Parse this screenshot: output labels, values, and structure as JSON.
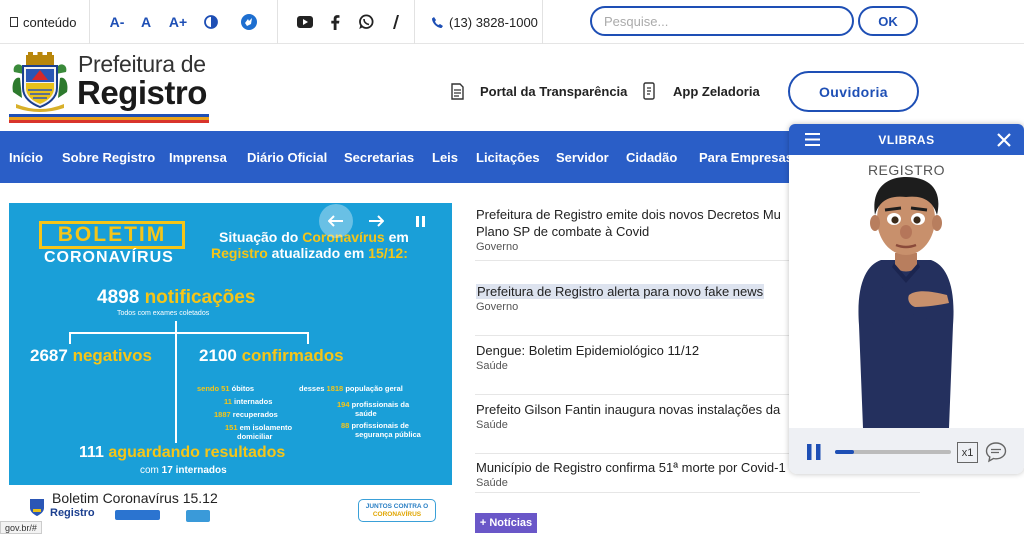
{
  "topbar": {
    "skip_content": "conteúdo",
    "font_decrease": "A-",
    "font_reset": "A",
    "font_increase": "A+",
    "phone": "(13) 3828-1000",
    "search_placeholder": "Pesquise...",
    "search_button": "OK"
  },
  "header": {
    "title_line1": "Prefeitura de",
    "title_line2": "Registro",
    "links": [
      "Portal da Transparência",
      "App Zeladoria"
    ],
    "ouvidoria": "Ouvidoria"
  },
  "nav": [
    "Início",
    "Sobre Registro",
    "Imprensa",
    "Diário Oficial",
    "Secretarias",
    "Leis",
    "Licitações",
    "Servidor",
    "Cidadão",
    "Para Empresas"
  ],
  "slider": {
    "badge_top": "BOLETIM",
    "badge_bottom": "CORONAVÍRUS",
    "heading_line1_a": "Situação do ",
    "heading_line1_b": "Coronavírus",
    "heading_line1_c": " em",
    "heading_line2_a": "Registro",
    "heading_line2_b": " atualizado em ",
    "heading_line2_c": "15/12:",
    "notif_num": "4898",
    "notif_label": "notificações",
    "notif_sub": "Todos com exames coletados",
    "neg_num": "2687",
    "neg_label": "negativos",
    "conf_num": "2100",
    "conf_label": "confirmados",
    "s1_num": "sendo 51",
    "s1_label": "óbitos",
    "s2_num": "11",
    "s2_label": "internados",
    "s3_num": "1887",
    "s3_label": "recuperados",
    "s4_num": "151",
    "s4_label": "em isolamento",
    "s4_label2": "domiciliar",
    "d1_pre": "desses",
    "d1_num": "1818",
    "d1_label": "população geral",
    "d2_num": "194",
    "d2_label": "profissionais da",
    "d2_label2": "saúde",
    "d3_num": "88",
    "d3_label": "profissionais de",
    "d3_label2": "segurança pública",
    "wait_num": "111",
    "wait_label": "aguardando resultados",
    "wait_sub_a": "com ",
    "wait_sub_b": "17 internados",
    "caption": "Boletim Coronavírus 15.12",
    "footer_logo": "Registro",
    "footer_badge_line1": "JUNTOS CONTRA O",
    "footer_badge_line2": "CORONAVÍRUS"
  },
  "news": [
    {
      "title": "Prefeitura de Registro emite dois novos Decretos Mu",
      "title2": "Plano SP de combate à Covid",
      "category": "Governo"
    },
    {
      "title": "Prefeitura de Registro alerta para novo fake news",
      "category": "Governo"
    },
    {
      "title": "Dengue: Boletim Epidemiológico 11/12",
      "category": "Saúde"
    },
    {
      "title": "Prefeito Gilson Fantin inaugura novas instalações da",
      "category": "Saúde"
    },
    {
      "title": "Município de Registro confirma 51ª morte por Covid-1",
      "category": "Saúde"
    }
  ],
  "more_news": "+ Notícias",
  "vlibras": {
    "title": "VLIBRAS",
    "region": "REGISTRO",
    "speed": "x1",
    "progress": 0.16
  },
  "status_url": "gov.br/#"
}
